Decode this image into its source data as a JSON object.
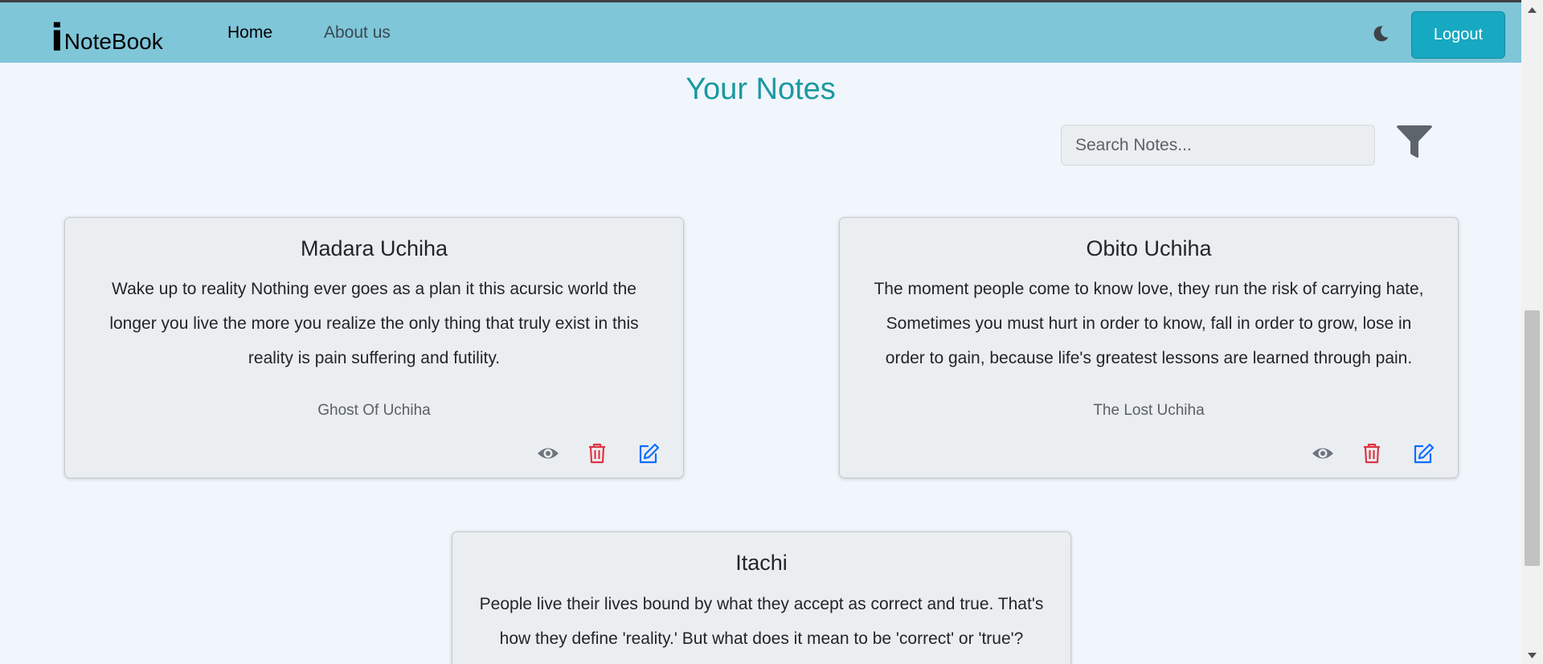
{
  "brand": {
    "letter": "i",
    "rest": "NoteBook"
  },
  "nav": {
    "home": "Home",
    "about": "About us"
  },
  "header": {
    "theme_icon": "moon-icon",
    "logout": "Logout"
  },
  "page": {
    "title": "Your Notes"
  },
  "search": {
    "placeholder": "Search Notes...",
    "value": ""
  },
  "filter_icon": "funnel-icon",
  "colors": {
    "navbar": "#7fc6d9",
    "title": "#1a9aa0",
    "logout": "#17a8c2",
    "delete": "#dc3545",
    "edit": "#0d6efd",
    "view": "#6c757d"
  },
  "notes": [
    {
      "title": "Madara Uchiha",
      "description": "Wake up to reality Nothing ever goes as a plan it this acursic world the longer you live the more you realize the only thing that truly exist in this reality is pain suffering and futility.",
      "tag": "Ghost Of Uchiha"
    },
    {
      "title": "Obito Uchiha",
      "description": "The moment people come to know love, they run the risk of carrying hate, Sometimes you must hurt in order to know, fall in order to grow, lose in order to gain, because life's greatest lessons are learned through pain.",
      "tag": "The Lost Uchiha"
    },
    {
      "title": "Itachi",
      "description": "People live their lives bound by what they accept as correct and true. That's how they define 'reality.' But what does it mean to be 'correct' or 'true'?",
      "tag": ""
    }
  ]
}
